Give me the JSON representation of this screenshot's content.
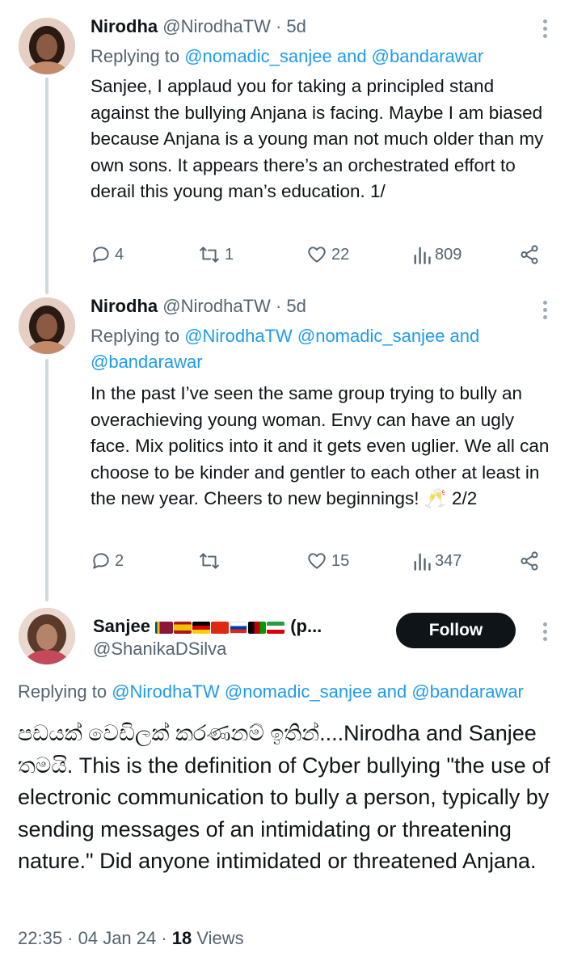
{
  "tweets": [
    {
      "name": "Nirodha",
      "handle": "@NirodhaTW",
      "time": "· 5d",
      "replying_prefix": "Replying to ",
      "replying_mentions": "@nomadic_sanjee and @bandarawar",
      "text": "Sanjee, I applaud you for taking a principled stand against the bullying Anjana is facing. Maybe I am biased because Anjana is a young man not much older than my own sons. It appears there’s an orchestrated effort to derail this young man’s education. 1/",
      "replies": "4",
      "reposts": "1",
      "likes": "22",
      "views": "809"
    },
    {
      "name": "Nirodha",
      "handle": "@NirodhaTW",
      "time": "· 5d",
      "replying_prefix": "Replying to ",
      "replying_mentions": "@NirodhaTW @nomadic_sanjee and @bandarawar",
      "text": "In the past I’ve seen the same group trying to bully an overachieving young woman. Envy can have an ugly face. Mix politics into it and it gets even uglier. We all can choose to be kinder and gentler to each other at least in the new year. Cheers to new beginnings! 🥂 2/2",
      "replies": "2",
      "reposts": "",
      "likes": "15",
      "views": "347"
    }
  ],
  "main": {
    "name": "Sanjee",
    "name_suffix": "(p...",
    "handle": "@ShanikaDSilva",
    "follow_label": "Follow",
    "replying_prefix": "Replying to ",
    "replying_mentions": "@NirodhaTW @nomadic_sanjee and @bandarawar",
    "text": "පඩයක් වෙඩිලක් කරණනම් ඉතින්....Nirodha and Sanjee තමයි. This is the definition of Cyber bullying \"the use of electronic communication to bully a person, typically by sending messages of an intimidating or threatening nature.\" Did anyone intimidated or threatened Anjana.",
    "time": "22:35 · 04 Jan 24 · ",
    "views_count": "18",
    "views_label": " Views"
  },
  "colors": {
    "text": "#0f1419",
    "secondary": "#536471",
    "link": "#1d9bf0",
    "thread_line": "#cfd9de",
    "follow_bg": "#0f1419"
  },
  "icons": [
    "reply-icon",
    "repost-icon",
    "like-icon",
    "views-icon",
    "share-icon",
    "more-icon"
  ]
}
